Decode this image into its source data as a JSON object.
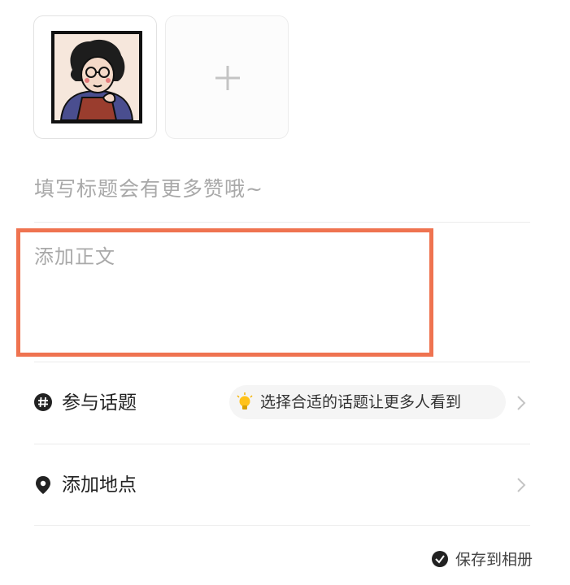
{
  "media": {
    "thumbnail_alt": "",
    "add_icon": "plus-icon"
  },
  "editor": {
    "title_placeholder": "填写标题会有更多赞哦~",
    "body_placeholder": "添加正文"
  },
  "options": [
    {
      "icon": "hashtag-icon",
      "label": "参与话题",
      "hint_icon": "lightbulb-icon",
      "hint": "选择合适的话题让更多人看到",
      "chevron": "chevron-right-icon"
    },
    {
      "icon": "location-pin-icon",
      "label": "添加地点",
      "chevron": "chevron-right-icon"
    }
  ],
  "footer": {
    "save_label": "保存到相册"
  },
  "colors": {
    "highlight": "#ef7350",
    "placeholder": "#a9a9a9",
    "divider": "#ececec"
  }
}
